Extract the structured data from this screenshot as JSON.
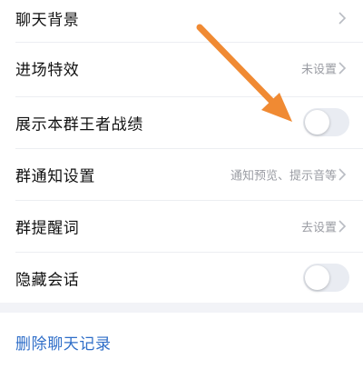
{
  "settings": {
    "items": [
      {
        "label": "聊天背景",
        "value": ""
      },
      {
        "label": "进场特效",
        "value": "未设置"
      },
      {
        "label": "展示本群王者战绩",
        "toggle_on": false
      },
      {
        "label": "群通知设置",
        "value": "通知预览、提示音等"
      },
      {
        "label": "群提醒词",
        "value": "去设置"
      },
      {
        "label": "隐藏会话",
        "toggle_on": false
      }
    ]
  },
  "actions": {
    "delete_chat_label": "删除聊天记录"
  },
  "colors": {
    "annotation_arrow": "#f08a33",
    "link_blue": "#2f6ec8",
    "toggle_off_track": "#e9ecf2"
  },
  "icons": {
    "chevron": "chevron-right-icon",
    "annotation": "arrow-icon"
  }
}
